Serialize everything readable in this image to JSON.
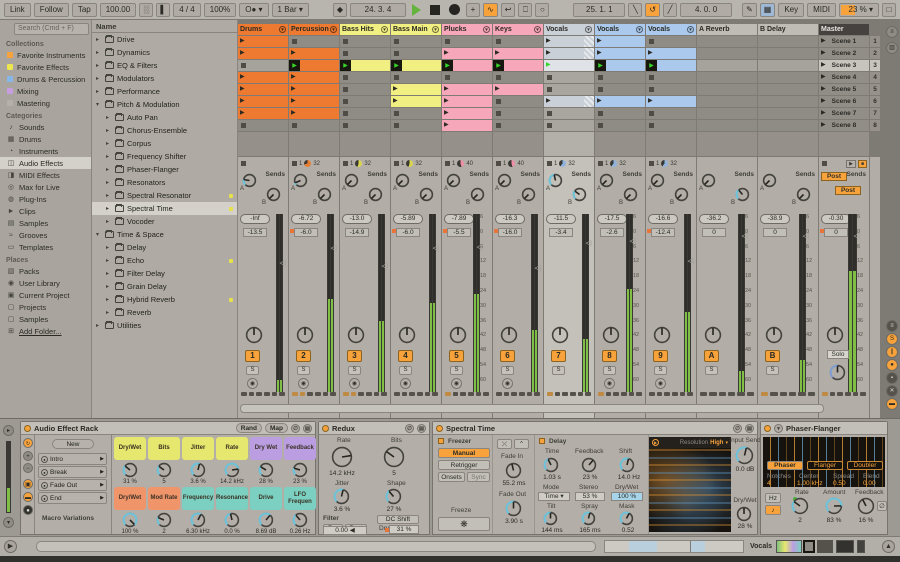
{
  "toolbar": {
    "link": "Link",
    "follow": "Follow",
    "tap": "Tap",
    "tempo": "100.00",
    "sig": "4 / 4",
    "quantize": "100%",
    "groove": "O●",
    "bar": "1 Bar",
    "pos": "24. 3. 4",
    "loop_start": "25. 1. 1",
    "loop_len": "4. 0. 0",
    "key": "Key",
    "midi": "MIDI",
    "cpu": "23 %"
  },
  "browser": {
    "search": "Search (Cmd + F)",
    "sections": [
      {
        "title": "Collections",
        "items": [
          {
            "label": "Favorite Instruments",
            "color": "#f7a23b"
          },
          {
            "label": "Favorite Effects",
            "color": "#ece64f"
          },
          {
            "label": "Drums & Percussion",
            "color": "#85b8e8"
          },
          {
            "label": "Mixing",
            "color": "#c89ddf"
          },
          {
            "label": "Mastering",
            "color": "#b5b1aa"
          }
        ]
      },
      {
        "title": "Categories",
        "items": [
          {
            "label": "Sounds",
            "glyph": "♪"
          },
          {
            "label": "Drums",
            "glyph": "▦"
          },
          {
            "label": "Instruments",
            "glyph": "◔"
          },
          {
            "label": "Audio Effects",
            "glyph": "◫",
            "selected": true
          },
          {
            "label": "MIDI Effects",
            "glyph": "◨"
          },
          {
            "label": "Max for Live",
            "glyph": "◎"
          },
          {
            "label": "Plug-Ins",
            "glyph": "◍"
          },
          {
            "label": "Clips",
            "glyph": "►"
          },
          {
            "label": "Samples",
            "glyph": "▤"
          },
          {
            "label": "Grooves",
            "glyph": "≈"
          },
          {
            "label": "Templates",
            "glyph": "▭"
          }
        ]
      },
      {
        "title": "Places",
        "items": [
          {
            "label": "Packs",
            "glyph": "▧"
          },
          {
            "label": "User Library",
            "glyph": "◉"
          },
          {
            "label": "Current Project",
            "glyph": "▣"
          },
          {
            "label": "Projects",
            "glyph": "▢"
          },
          {
            "label": "Samples",
            "glyph": "▢"
          },
          {
            "label": "Add Folder...",
            "glyph": "⊞",
            "underline": true
          }
        ]
      }
    ]
  },
  "tree": {
    "header": "Name",
    "items": [
      {
        "label": "Drive",
        "depth": 0,
        "arrow": "▸"
      },
      {
        "label": "Dynamics",
        "depth": 0,
        "arrow": "▸"
      },
      {
        "label": "EQ & Filters",
        "depth": 0,
        "arrow": "▸"
      },
      {
        "label": "Modulators",
        "depth": 0,
        "arrow": "▸"
      },
      {
        "label": "Performance",
        "depth": 0,
        "arrow": "▸"
      },
      {
        "label": "Pitch & Modulation",
        "depth": 0,
        "arrow": "▾"
      },
      {
        "label": "Auto Pan",
        "depth": 1,
        "arrow": "▸"
      },
      {
        "label": "Chorus-Ensemble",
        "depth": 1,
        "arrow": "▸"
      },
      {
        "label": "Corpus",
        "depth": 1,
        "arrow": "▸"
      },
      {
        "label": "Frequency Shifter",
        "depth": 1,
        "arrow": "▸"
      },
      {
        "label": "Phaser-Flanger",
        "depth": 1,
        "arrow": "▸"
      },
      {
        "label": "Resonators",
        "depth": 1,
        "arrow": "▸"
      },
      {
        "label": "Spectral Resonator",
        "depth": 1,
        "arrow": "▸",
        "dot": true
      },
      {
        "label": "Spectral Time",
        "depth": 1,
        "arrow": "▸",
        "dot": true,
        "selected": true
      },
      {
        "label": "Vocoder",
        "depth": 1,
        "arrow": "▸"
      },
      {
        "label": "Time & Space",
        "depth": 0,
        "arrow": "▾"
      },
      {
        "label": "Delay",
        "depth": 1,
        "arrow": "▸"
      },
      {
        "label": "Echo",
        "depth": 1,
        "arrow": "▸",
        "dot": true
      },
      {
        "label": "Filter Delay",
        "depth": 1,
        "arrow": "▸"
      },
      {
        "label": "Grain Delay",
        "depth": 1,
        "arrow": "▸"
      },
      {
        "label": "Hybrid Reverb",
        "depth": 1,
        "arrow": "▸",
        "dot": true
      },
      {
        "label": "Reverb",
        "depth": 1,
        "arrow": "▸"
      },
      {
        "label": "Utilities",
        "depth": 0,
        "arrow": "▸"
      }
    ]
  },
  "session": {
    "sends_label": "Sends",
    "meter_scale": [
      "6",
      "0",
      "6",
      "12",
      "18",
      "24",
      "30",
      "36",
      "42",
      "48",
      "54",
      "60"
    ],
    "tracks": [
      {
        "name": "Drums",
        "color": "#ee7a31",
        "clips": [
          "clip",
          "clip",
          "stop",
          "clip",
          "clip",
          "clip",
          "clip",
          "stop"
        ],
        "status": null,
        "sendA": 0.2,
        "sendB": 0,
        "mixer": {
          "num": "1",
          "peak": "-Inf",
          "vol": "-13.5",
          "db": -13.5,
          "meter": 0.07,
          "armdot": false,
          "arm": true,
          "scale": false,
          "dashes": 0
        }
      },
      {
        "name": "Percussion",
        "color": "#ee7a31",
        "clips": [
          "stop",
          "clip",
          "playclip",
          "clip",
          "clip",
          "clip",
          "clip",
          "stop"
        ],
        "status": {
          "q": "1",
          "len": "32",
          "frac": 0.7,
          "color": "#e87c30"
        },
        "sendA": 0.08,
        "sendB": 0,
        "mixer": {
          "num": "2",
          "peak": "-6.72",
          "vol": "-6.0",
          "db": -6.0,
          "meter": 0.52,
          "armdot": true,
          "arm": true,
          "scale": false,
          "dashes": 2
        }
      },
      {
        "name": "Bass Hits",
        "color": "#f1ee82",
        "clips": [
          "stop",
          "stop",
          "playclip",
          "stop",
          "stop",
          "stop",
          "stop",
          "stop"
        ],
        "status": {
          "q": "1",
          "len": "32",
          "frac": 0.55,
          "color": "#d8d44e"
        },
        "sendA": 0,
        "sendB": 0,
        "mixer": {
          "num": "3",
          "peak": "-13.0",
          "vol": "-14.9",
          "db": -14.9,
          "meter": 0.4,
          "armdot": false,
          "arm": true,
          "scale": false,
          "dashes": 2
        }
      },
      {
        "name": "Bass Main",
        "color": "#f1ee82",
        "clips": [
          "stop",
          "stop",
          "playclip",
          "stop",
          "clip",
          "clip",
          "stop",
          "stop"
        ],
        "status": {
          "q": "1",
          "len": "32",
          "frac": 0.55,
          "color": "#d8d44e"
        },
        "sendA": 0,
        "sendB": 0,
        "mixer": {
          "num": "4",
          "peak": "-5.89",
          "vol": "-6.0",
          "db": -6.0,
          "meter": 0.5,
          "armdot": true,
          "arm": true,
          "scale": false,
          "dashes": 0
        }
      },
      {
        "name": "Plucks",
        "color": "#f6a7b9",
        "clips": [
          "stop",
          "clip",
          "playclip",
          "stop",
          "clip",
          "clip",
          "clip",
          "clip"
        ],
        "status": {
          "q": "1",
          "len": "40",
          "frac": 0.45,
          "color": "#ef8fa6"
        },
        "sendA": 0,
        "sendB": 0,
        "mixer": {
          "num": "5",
          "peak": "-7.89",
          "vol": "-5.5",
          "db": -5.5,
          "meter": 0.55,
          "armdot": true,
          "arm": true,
          "scale": true,
          "dashes": 1
        }
      },
      {
        "name": "Keys",
        "color": "#f6a7b9",
        "clips": [
          "stop",
          "clip",
          "playclip",
          "stop",
          "clip",
          "stop",
          "stop",
          "stop"
        ],
        "status": {
          "q": "1",
          "len": "40",
          "frac": 0.45,
          "color": "#ef8fa6"
        },
        "sendA": 0,
        "sendB": 0,
        "mixer": {
          "num": "6",
          "peak": "-16.3",
          "vol": "-16.0",
          "db": -16.0,
          "meter": 0.35,
          "armdot": true,
          "arm": true,
          "scale": false,
          "dashes": 0
        }
      },
      {
        "name": "Vocals",
        "color": "#c9d0d8",
        "group": true,
        "selected": true,
        "clips": [
          "gclip",
          "gclip",
          "gplay",
          "stop",
          "stop",
          "gclip",
          "stop",
          "stop"
        ],
        "status": {
          "q": "1",
          "len": "32",
          "frac": 0.6,
          "color": "#8fb3dc"
        },
        "sendA": 0.45,
        "sendB": 0.3,
        "mixer": {
          "num": "7",
          "peak": "-11.5",
          "vol": "-3.4",
          "db": -3.4,
          "meter": 0.3,
          "armdot": false,
          "arm": false,
          "scale": false,
          "dashes": 1
        }
      },
      {
        "name": "Vocals",
        "color": "#aac9ec",
        "clips": [
          "clip",
          "clip",
          "playclip",
          "stop",
          "stop",
          "clip",
          "stop",
          "stop"
        ],
        "status": {
          "q": "1",
          "len": "32",
          "frac": 0.6,
          "color": "#8fb3dc"
        },
        "sendA": 0,
        "sendB": 0,
        "mixer": {
          "num": "8",
          "peak": "-17.5",
          "vol": "-2.6",
          "db": -2.6,
          "meter": 0.58,
          "armdot": false,
          "arm": true,
          "scale": true,
          "dashes": 1
        }
      },
      {
        "name": "Vocals",
        "color": "#aac9ec",
        "clips": [
          "stop",
          "clip",
          "playclip",
          "stop",
          "stop",
          "clip",
          "stop",
          "stop"
        ],
        "status": {
          "q": "1",
          "len": "32",
          "frac": 0.6,
          "color": "#8fb3dc"
        },
        "sendA": 0,
        "sendB": 0,
        "mixer": {
          "num": "9",
          "peak": "-16.6",
          "vol": "-12.4",
          "db": -12.4,
          "meter": 0.45,
          "armdot": true,
          "arm": true,
          "scale": false,
          "dashes": 0
        }
      }
    ],
    "returns": [
      {
        "name": "A Reverb",
        "sendA": 0,
        "sendB": 0.35,
        "mixer": {
          "num": "A",
          "peak": "-36.2",
          "vol": "0",
          "db": 0,
          "meter": 0.12,
          "armdot": false,
          "arm": false,
          "scale": true,
          "dashes": 0
        }
      },
      {
        "name": "B Delay",
        "sendA": 0,
        "sendB": 0,
        "mixer": {
          "num": "B",
          "peak": "-38.9",
          "vol": "0",
          "db": 0,
          "meter": 0.18,
          "armdot": false,
          "arm": false,
          "scale": true,
          "dashes": 1
        }
      }
    ],
    "master": {
      "name": "Master",
      "scenes": [
        "Scene 1",
        "Scene 2",
        "Scene 3",
        "Scene 4",
        "Scene 5",
        "Scene 6",
        "Scene 7",
        "Scene 8"
      ],
      "selected_scene": 2,
      "posts": [
        "Post",
        "Post"
      ],
      "solo": "Solo",
      "mixer": {
        "peak": "-0.30",
        "vol": "0",
        "db": 0,
        "meter": 0.68,
        "armdot": true,
        "scale": true,
        "dashes": 1
      }
    },
    "rail_toggles": [
      {
        "glyph": "≡",
        "on": false
      },
      {
        "glyph": "S",
        "on": true
      },
      {
        "glyph": "∥",
        "on": true
      },
      {
        "glyph": "●",
        "on": true
      },
      {
        "glyph": "▪",
        "on": false
      },
      {
        "glyph": "✕",
        "on": false
      },
      {
        "glyph": "▬",
        "on": true
      }
    ]
  },
  "devices": {
    "rack": {
      "title": "Audio Effect Rack",
      "rand": "Rand",
      "map": "Map",
      "new_btn": "New",
      "variations": [
        "Intro",
        "Break",
        "Fade Out",
        "End"
      ],
      "variations_label": "Macro Variations",
      "macros": [
        {
          "name": "Dry/Wet",
          "value": "31 %",
          "color": "#e6e76e",
          "f": 0.31
        },
        {
          "name": "Bits",
          "value": "5",
          "color": "#e6e76e",
          "f": 0.3
        },
        {
          "name": "Jitter",
          "value": "3.6 %",
          "color": "#e6e76e",
          "f": 0.55
        },
        {
          "name": "Rate",
          "value": "14.2 kHz",
          "color": "#e6e76e",
          "f": 0.8
        },
        {
          "name": "Dry Wet",
          "value": "28 %",
          "color": "#bb9ee2",
          "f": 0.28
        },
        {
          "name": "Feedback",
          "value": "23 %",
          "color": "#bb9ee2",
          "f": 0.23
        },
        {
          "name": "Dry/Wet",
          "value": "100 %",
          "color": "#f0946a",
          "f": 1
        },
        {
          "name": "Mod Rate",
          "value": "2",
          "color": "#f0946a",
          "f": 0.25
        },
        {
          "name": "Frequency",
          "value": "6.30 kHz",
          "color": "#7bd0c1",
          "f": 0.6
        },
        {
          "name": "Resonance",
          "value": "0.0 %",
          "color": "#7bd0c1",
          "f": 0.45
        },
        {
          "name": "Drive",
          "value": "8.69 dB",
          "color": "#7bd0c1",
          "f": 0.65
        },
        {
          "name": "LFO Frequen",
          "value": "0.26 Hz",
          "color": "#7bd0c1",
          "f": 0.35
        }
      ]
    },
    "redux": {
      "title": "Redux",
      "rate_label": "Rate",
      "rate": "14.2 kHz",
      "bits_label": "Bits",
      "bits": "5",
      "jitter_label": "Jitter",
      "jitter": "3.6 %",
      "shape_label": "Shape",
      "shape": "27 %",
      "filter_label": "Filter",
      "pre": "Pre",
      "post": "Post",
      "freq": "0.00",
      "dc": "DC Shift",
      "dw_label": "Dry/Wet",
      "dw": "31 %"
    },
    "spectral": {
      "title": "Spectral Time",
      "freezer": "Freezer",
      "manual": "Manual",
      "retrigger": "Retrigger",
      "onsets": "Onsets",
      "sync": "Sync",
      "fade_in_label": "Fade In",
      "fade_in": "55.2 ms",
      "fade_out_label": "Fade Out",
      "fade_out": "3.90 s",
      "freeze": "Freeze",
      "delay": "Delay",
      "time_label": "Time",
      "time": "1.03 s",
      "fb_label": "Feedback",
      "fb": "23 %",
      "shift_label": "Shift",
      "shift": "14.0 Hz",
      "mode_label": "Mode",
      "mode": "Time",
      "stereo_label": "Stereo",
      "stereo": "53 %",
      "dw_label": "Dry/Wet",
      "dw": "100 %",
      "tilt_label": "Tilt",
      "tilt": "144 ms",
      "spray_label": "Spray",
      "spray": "165 ms",
      "mask_label": "Mask",
      "mask": "0.52",
      "res_label": "Resolution",
      "res": "High",
      "input_label": "Input Send",
      "input": "0.0 dB",
      "out_dw_label": "Dry/Wet",
      "out_dw": "28 %"
    },
    "phaser": {
      "title": "Phaser-Flanger",
      "modes": [
        "Phaser",
        "Flanger",
        "Doubler"
      ],
      "notches_label": "Notches",
      "notches": "4",
      "center_label": "Center",
      "center": "1.00 kHz",
      "spread_label": "Spread",
      "spread": "0.50",
      "blend_label": "Blend",
      "blend": "0.00",
      "hz": "Hz",
      "rate_label": "Rate",
      "rate": "2",
      "amount_label": "Amount",
      "amount": "83 %",
      "fb_label": "Feedback",
      "fb": "16 %"
    }
  },
  "status_bar": {
    "track": "Vocals"
  }
}
